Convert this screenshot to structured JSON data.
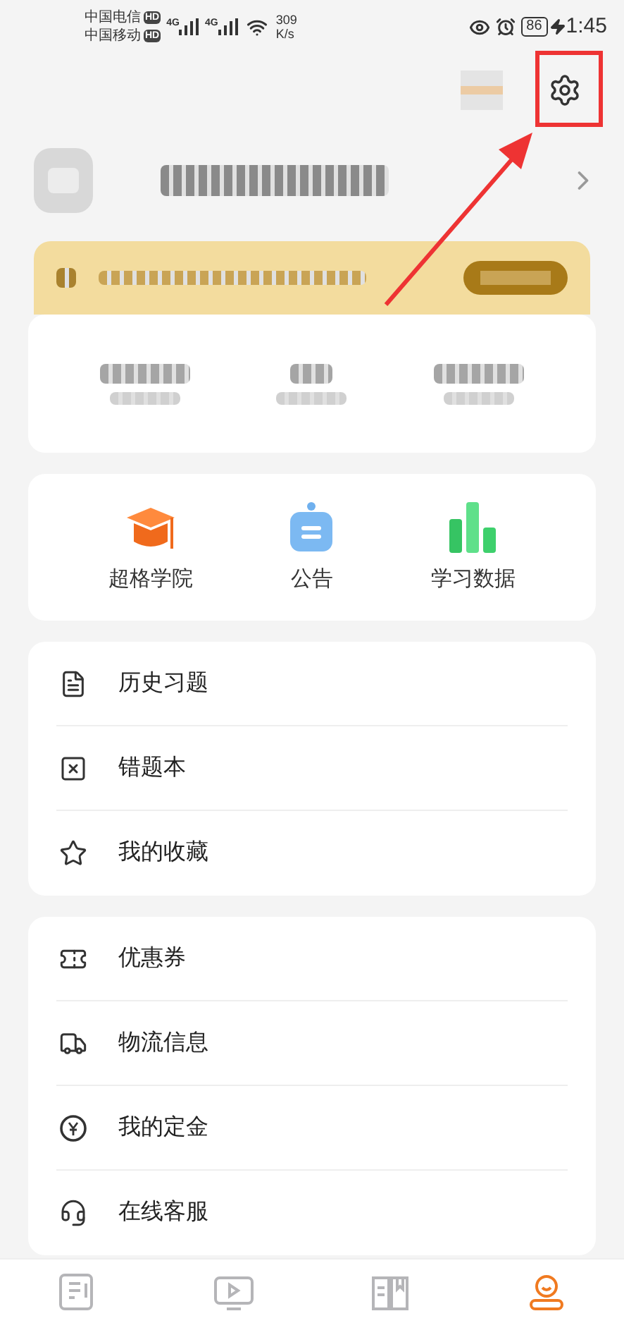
{
  "status_bar": {
    "carriers": [
      {
        "name": "中国电信",
        "badge": "HD"
      },
      {
        "name": "中国移动",
        "badge": "HD"
      }
    ],
    "networks": [
      "4G",
      "4G"
    ],
    "speed_value": "309",
    "speed_unit": "K/s",
    "battery": "86",
    "time": "1:45"
  },
  "shortcuts": [
    {
      "label": "超格学院",
      "kind": "academy"
    },
    {
      "label": "公告",
      "kind": "notice"
    },
    {
      "label": "学习数据",
      "kind": "stats"
    }
  ],
  "menu_groups": [
    [
      {
        "label": "历史习题",
        "kind": "history"
      },
      {
        "label": "错题本",
        "kind": "mistakes"
      },
      {
        "label": "我的收藏",
        "kind": "favorites"
      }
    ],
    [
      {
        "label": "优惠券",
        "kind": "coupon"
      },
      {
        "label": "物流信息",
        "kind": "shipping"
      },
      {
        "label": "我的定金",
        "kind": "deposit"
      },
      {
        "label": "在线客服",
        "kind": "support"
      }
    ]
  ],
  "bottom_nav": [
    {
      "kind": "practice",
      "selected": false
    },
    {
      "kind": "course",
      "selected": false
    },
    {
      "kind": "my_course",
      "selected": false
    },
    {
      "kind": "profile",
      "selected": true
    }
  ]
}
